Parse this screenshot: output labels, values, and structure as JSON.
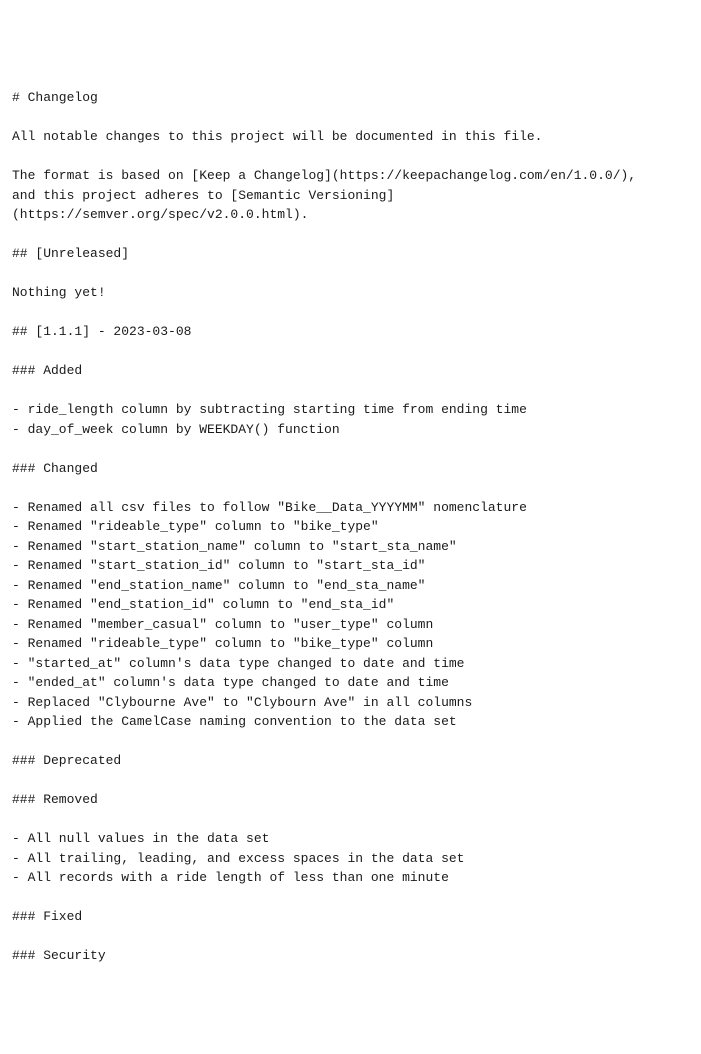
{
  "title_line": "# Changelog",
  "intro_line": "All notable changes to this project will be documented in this file.",
  "format_line": "The format is based on [Keep a Changelog](https://keepachangelog.com/en/1.0.0/),",
  "adheres_line": "and this project adheres to [Semantic Versioning](https://semver.org/spec/v2.0.0.html).",
  "unreleased": {
    "heading": "## [Unreleased]",
    "body": "Nothing yet!"
  },
  "release": {
    "heading": "## [1.1.1] - 2023-03-08",
    "added": {
      "heading": "### Added",
      "items": [
        "- ride_length column by subtracting starting time from ending time",
        "- day_of_week column by WEEKDAY() function"
      ]
    },
    "changed": {
      "heading": "### Changed",
      "items": [
        "- Renamed all csv files to follow \"Bike__Data_YYYYMM\" nomenclature",
        "- Renamed \"rideable_type\" column to \"bike_type\"",
        "- Renamed \"start_station_name\" column to \"start_sta_name\"",
        "- Renamed \"start_station_id\" column to \"start_sta_id\"",
        "- Renamed \"end_station_name\" column to \"end_sta_name\"",
        "- Renamed \"end_station_id\" column to \"end_sta_id\"",
        "- Renamed \"member_casual\" column to \"user_type\" column",
        "- Renamed \"rideable_type\" column to \"bike_type\" column",
        "- \"started_at\" column's data type changed to date and time",
        "- \"ended_at\" column's data type changed to date and time",
        "- Replaced \"Clybourne Ave\" to \"Clybourn Ave\" in all columns",
        "- Applied the CamelCase naming convention to the data set"
      ]
    },
    "deprecated": {
      "heading": "### Deprecated"
    },
    "removed": {
      "heading": "### Removed",
      "items": [
        "- All null values in the data set",
        "- All trailing, leading, and excess spaces in the data set",
        "- All records with a ride length of less than one minute"
      ]
    },
    "fixed": {
      "heading": "### Fixed"
    },
    "security": {
      "heading": "### Security"
    }
  }
}
